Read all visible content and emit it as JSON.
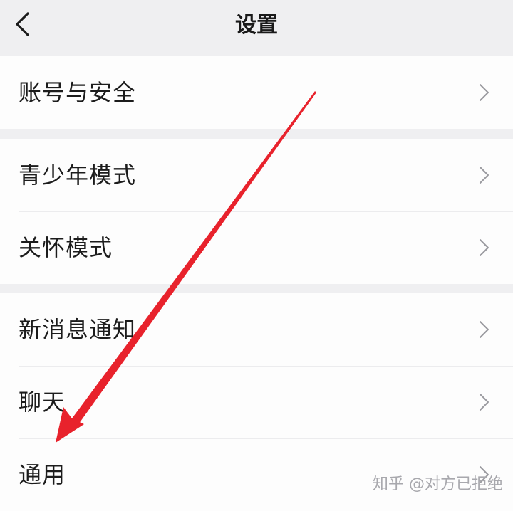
{
  "header": {
    "title": "设置",
    "back_icon": "chevron-left-icon"
  },
  "groups": [
    {
      "items": [
        {
          "label": "账号与安全"
        }
      ]
    },
    {
      "items": [
        {
          "label": "青少年模式"
        },
        {
          "label": "关怀模式"
        }
      ]
    },
    {
      "items": [
        {
          "label": "新消息通知"
        },
        {
          "label": "聊天"
        },
        {
          "label": "通用"
        }
      ]
    }
  ],
  "row_icon": "chevron-right-icon",
  "watermark": "知乎 @对方已拒绝",
  "colors": {
    "background": "#efeff1",
    "row_background": "#fdfdfd",
    "text": "#1c1c1c",
    "chevron": "#9a9a9f",
    "annotation_arrow": "#e8222c"
  }
}
